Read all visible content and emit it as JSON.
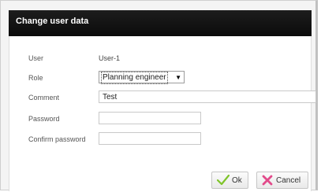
{
  "dialog": {
    "title": "Change user data"
  },
  "form": {
    "user_label": "User",
    "user_value": "User-1",
    "role_label": "Role",
    "role_value": "Planning engineer",
    "comment_label": "Comment",
    "comment_value": "Test",
    "password_label": "Password",
    "password_value": "",
    "confirm_label": "Confirm password",
    "confirm_value": ""
  },
  "buttons": {
    "ok_label": "Ok",
    "cancel_label": "Cancel"
  },
  "icons": {
    "ok_icon": "checkmark-icon",
    "cancel_icon": "cross-icon",
    "dropdown_icon": "chevron-down-icon"
  },
  "colors": {
    "titlebar": "#0b0b0b",
    "ok_green": "#7fc42a",
    "cancel_pink": "#e24a8a"
  }
}
